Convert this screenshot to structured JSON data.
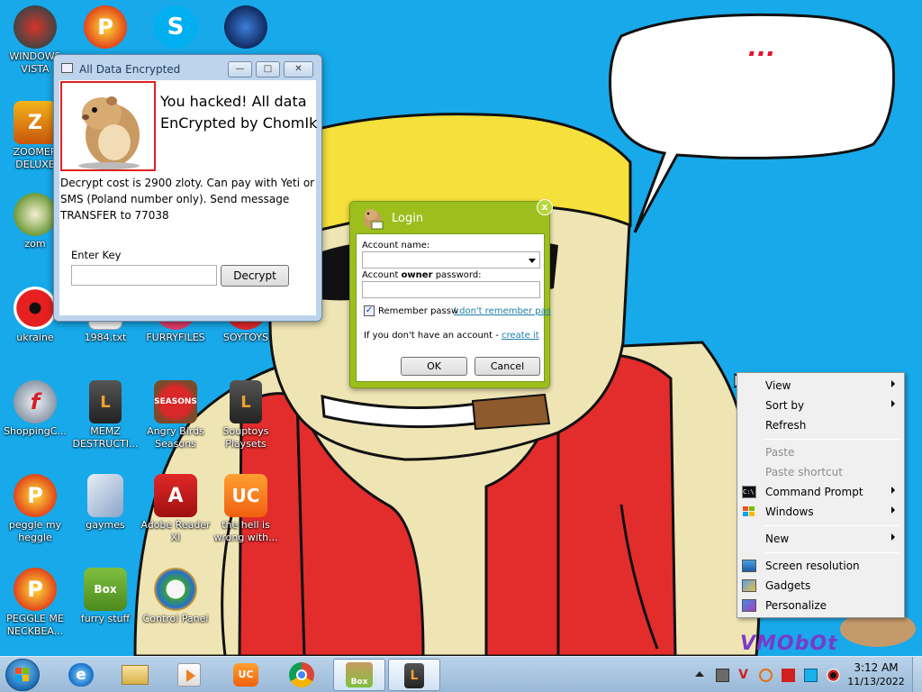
{
  "wallpaper": {
    "speech_bubble": [
      "...",
      "",
      ""
    ],
    "signature": "VMObOt"
  },
  "desktop_icons": [
    {
      "label": "WINDOWS VISTA",
      "icon": "windows-vista-icon"
    },
    {
      "label": "",
      "icon": "peggle-icon"
    },
    {
      "label": "",
      "icon": "skype-icon"
    },
    {
      "label": "",
      "icon": "globe-icon"
    },
    {
      "label": "ZOOMER DELUXE",
      "icon": "zoomer-icon"
    },
    {
      "label": "zom",
      "icon": "zombie-flower-icon"
    },
    {
      "label": "ukraine",
      "icon": "radiation-icon"
    },
    {
      "label": "1984.txt",
      "icon": "text-file-icon"
    },
    {
      "label": "FURRYFILES",
      "icon": "folder-icon"
    },
    {
      "label": "SOYTOYS",
      "icon": "app-icon"
    },
    {
      "label": "ShoppingC...",
      "icon": "flash-icon"
    },
    {
      "label": "MEMZ DESTRUCTI...",
      "icon": "loader-icon"
    },
    {
      "label": "Angry Birds Seasons",
      "icon": "angry-birds-icon"
    },
    {
      "label": "Souptoys Playsets",
      "icon": "loader-icon"
    },
    {
      "label": "peggle my heggle",
      "icon": "peggle-icon"
    },
    {
      "label": "gaymes",
      "icon": "media-folder-icon"
    },
    {
      "label": "Adobe Reader XI",
      "icon": "adobe-reader-icon"
    },
    {
      "label": "the hell is wrong with...",
      "icon": "uc-browser-icon"
    },
    {
      "label": "PEGGLE ME NECKBEA...",
      "icon": "peggle-icon"
    },
    {
      "label": "furry stuff",
      "icon": "hamster-box-icon"
    },
    {
      "label": "Control Panel",
      "icon": "control-panel-icon"
    }
  ],
  "ransom_window": {
    "title": "All Data Encrypted",
    "minimize": "—",
    "maximize": "□",
    "close": "✕",
    "headline": "You hacked! All data EnCrypted by ChomIk",
    "message": "Decrypt cost is 2900 zloty. Can pay with Yeti or SMS (Poland number only). Send message TRANSFER to 77038",
    "key_label": "Enter Key",
    "key_value": "",
    "decrypt_button": "Decrypt"
  },
  "login_window": {
    "title": "Login",
    "close": "x",
    "account_name_label": "Account name:",
    "password_label_prefix": "Account ",
    "password_label_bold": "owner",
    "password_label_suffix": " password:",
    "remember_label": "Remember passw",
    "forgot_link": "I don't remember pas",
    "no_account_text": "If you don't have an account - ",
    "create_link": "create it",
    "ok_button": "OK",
    "cancel_button": "Cancel"
  },
  "context_menu": {
    "items": [
      {
        "label": "View",
        "submenu": true,
        "disabled": false,
        "icon": ""
      },
      {
        "label": "Sort by",
        "submenu": true,
        "disabled": false,
        "icon": ""
      },
      {
        "label": "Refresh",
        "submenu": false,
        "disabled": false,
        "icon": ""
      },
      {
        "label": "Paste",
        "submenu": false,
        "disabled": true,
        "icon": ""
      },
      {
        "label": "Paste shortcut",
        "submenu": false,
        "disabled": true,
        "icon": ""
      },
      {
        "label": "Command Prompt",
        "submenu": true,
        "disabled": false,
        "icon": "cmd-icon"
      },
      {
        "label": "Windows",
        "submenu": true,
        "disabled": false,
        "icon": "windows-flag-icon"
      },
      {
        "label": "New",
        "submenu": true,
        "disabled": false,
        "icon": ""
      },
      {
        "label": "Screen resolution",
        "submenu": false,
        "disabled": false,
        "icon": "monitor-icon"
      },
      {
        "label": "Gadgets",
        "submenu": false,
        "disabled": false,
        "icon": "gadgets-icon"
      },
      {
        "label": "Personalize",
        "submenu": false,
        "disabled": false,
        "icon": "personalize-icon"
      }
    ]
  },
  "taskbar": {
    "pinned": [
      "internet-explorer-icon",
      "explorer-folder-icon",
      "media-player-icon",
      "uc-browser-icon",
      "chrome-icon",
      "hamster-box-icon",
      "loader-icon"
    ],
    "clock_time": "3:12 AM",
    "clock_date": "11/13/2022"
  },
  "colors": {
    "desktop": "#17a9ea",
    "speech_text": "#e1142c",
    "login_frame": "#9cbf1e",
    "ransom_frame": "#bed4ec"
  }
}
